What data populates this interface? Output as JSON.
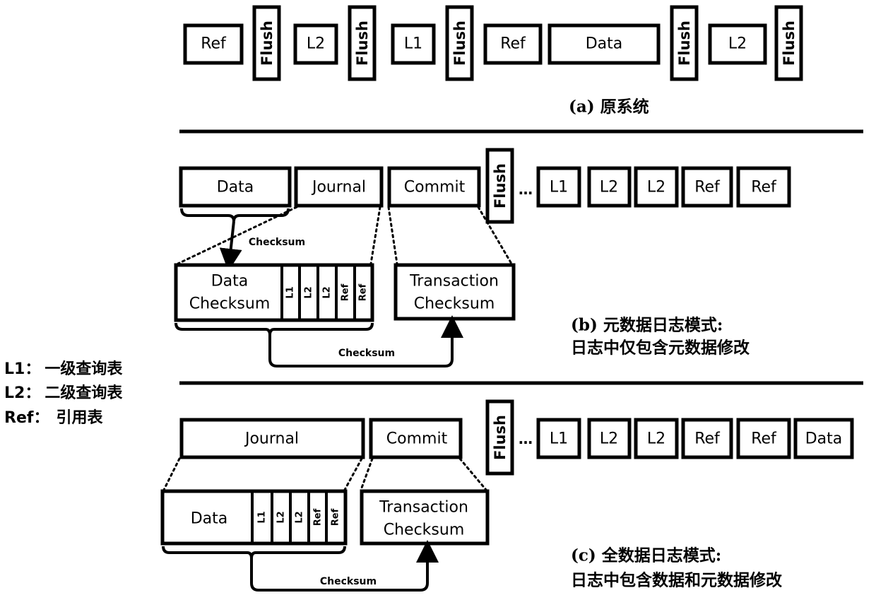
{
  "legend": [
    {
      "key": "L1",
      "sep": "：",
      "desc": "一级查询表"
    },
    {
      "key": "L2",
      "sep": "：",
      "desc": "二级查询表"
    },
    {
      "key": "Ref",
      "sep": "：",
      "desc": "引用表"
    }
  ],
  "panel_a": {
    "caption": "(a) 原系统",
    "sequence": [
      "Ref",
      "Flush",
      "L2",
      "Flush",
      "L1",
      "Flush",
      "Ref",
      "Data",
      "Flush",
      "L2",
      "Flush"
    ]
  },
  "panel_b": {
    "caption_line1": "(b) 元数据日志模式:",
    "caption_line2": "日志中仅包含元数据修改",
    "sequence": [
      "Data",
      "Journal",
      "Commit",
      "Flush"
    ],
    "ellipsis": "…",
    "after_flush": [
      "L1",
      "L2",
      "L2",
      "Ref",
      "Ref"
    ],
    "journal_block": {
      "main_line1": "Data",
      "main_line2": "Checksum",
      "cells": [
        "L1",
        "L2",
        "L2",
        "Ref",
        "Ref"
      ]
    },
    "commit_block": {
      "line1": "Transaction",
      "line2": "Checksum"
    },
    "checksum_label_top": "Checksum",
    "checksum_label_bottom": "Checksum"
  },
  "panel_c": {
    "caption_line1": "(c) 全数据日志模式:",
    "caption_line2": "日志中包含数据和元数据修改",
    "sequence": [
      "Journal",
      "Commit",
      "Flush"
    ],
    "ellipsis": "…",
    "after_flush": [
      "L1",
      "L2",
      "L2",
      "Ref",
      "Ref",
      "Data"
    ],
    "journal_block": {
      "main_line1": "Data",
      "cells": [
        "L1",
        "L2",
        "L2",
        "Ref",
        "Ref"
      ]
    },
    "commit_block": {
      "line1": "Transaction",
      "line2": "Checksum"
    },
    "checksum_label_bottom": "Checksum"
  }
}
